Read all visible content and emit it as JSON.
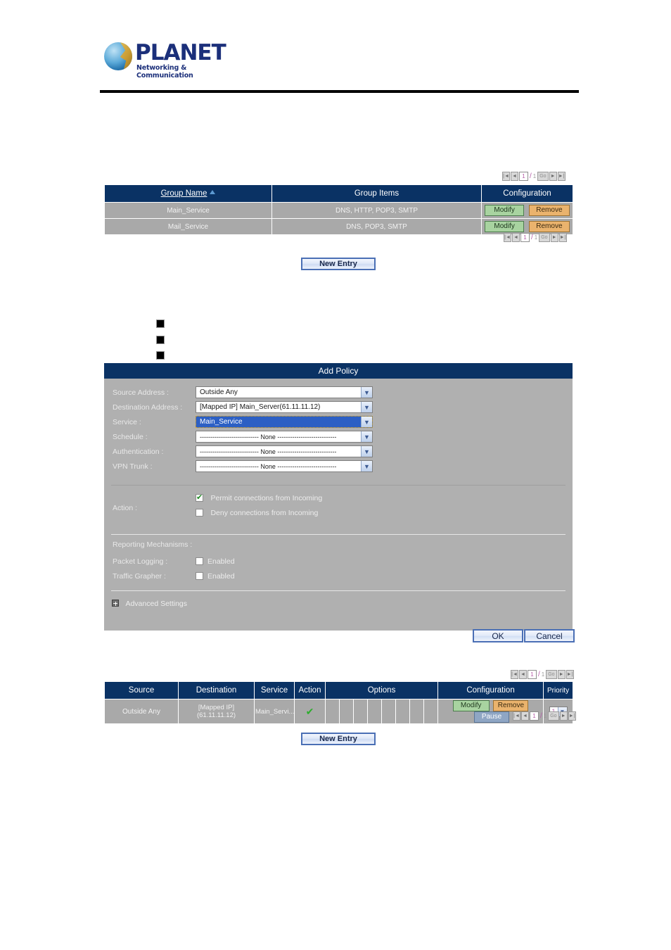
{
  "brand": {
    "name": "PLANET",
    "tagline": "Networking & Communication",
    "logo_icon": "planet-globe-icon"
  },
  "service_group": {
    "pager_top": {
      "first_icon": "first-page-icon",
      "prev_icon": "prev-page-icon",
      "current": "1",
      "separator": "/",
      "total": "1",
      "go_label": "Go",
      "next_icon": "next-page-icon",
      "last_icon": "last-page-icon"
    },
    "headers": [
      "Group Name",
      "Group Items",
      "Configuration"
    ],
    "sort_indicator": "sort-ascending-icon",
    "rows": [
      {
        "group_name": "Main_Service",
        "group_items": "DNS, HTTP, POP3, SMTP",
        "modify_label": "Modify",
        "remove_label": "Remove"
      },
      {
        "group_name": "Mail_Service",
        "group_items": "DNS, POP3, SMTP",
        "modify_label": "Modify",
        "remove_label": "Remove"
      }
    ],
    "new_entry_label": "New Entry"
  },
  "add_policy": {
    "title": "Add Policy",
    "fields": [
      {
        "label": "Source Address :",
        "value": "Outside Any",
        "focused": false
      },
      {
        "label": "Destination Address :",
        "value": "[Mapped IP] Main_Server(61.11.11.12)",
        "focused": false
      },
      {
        "label": "Service :",
        "value": "Main_Service",
        "focused": true
      },
      {
        "label": "Schedule :",
        "value": "---------------------------- None ----------------------------",
        "focused": false
      },
      {
        "label": "Authentication :",
        "value": "---------------------------- None ----------------------------",
        "focused": false
      },
      {
        "label": "VPN Trunk :",
        "value": "---------------------------- None ----------------------------",
        "focused": false
      }
    ],
    "action_label": "Action :",
    "action_options": [
      {
        "label": "Permit connections from Incoming",
        "checked": true
      },
      {
        "label": "Deny connections from Incoming",
        "checked": false
      }
    ],
    "reporting_label": "Reporting Mechanisms :",
    "reporting": [
      {
        "label": "Packet Logging :",
        "option": "Enabled",
        "checked": false
      },
      {
        "label": "Traffic Grapher :",
        "option": "Enabled",
        "checked": false
      }
    ],
    "advanced_label": "Advanced Settings",
    "advanced_icon": "expand-plus-icon",
    "ok_label": "OK",
    "cancel_label": "Cancel"
  },
  "policy_table": {
    "pager": {
      "first_icon": "first-page-icon",
      "prev_icon": "prev-page-icon",
      "current": "1",
      "separator": "/",
      "total": "1",
      "go_label": "Go",
      "next_icon": "next-page-icon",
      "last_icon": "last-page-icon"
    },
    "headers": [
      "Source",
      "Destination",
      "Service",
      "Action",
      "Options",
      "Configuration",
      "Priority"
    ],
    "row": {
      "source": "Outside Any",
      "destination": "[Mapped IP](61.11.11.12)",
      "service": "Main_Servi...",
      "action_icon": "green-check-icon",
      "options_cells": 8,
      "modify_label": "Modify",
      "remove_label": "Remove",
      "pause_label": "Pause",
      "priority_value": "1"
    },
    "new_entry_label": "New Entry"
  },
  "colors": {
    "header_navy": "#0a3264",
    "row_gray": "#a9a9a9",
    "panel_gray": "#b0b0b0",
    "modify_green": "#a8d3a0",
    "remove_orange": "#eab36d",
    "pause_blue": "#8fa6c4",
    "accent_blue": "#2c5fc4",
    "check_green": "#2cae2c"
  }
}
